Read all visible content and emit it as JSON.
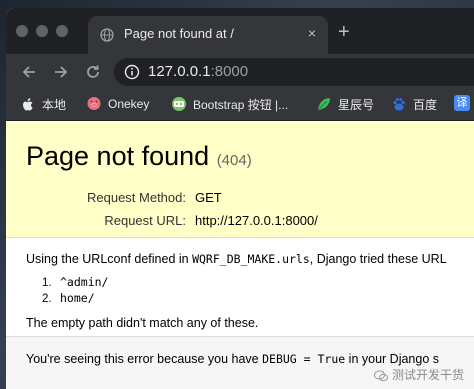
{
  "browser": {
    "tab": {
      "title": "Page not found at /",
      "close_symbol": "×"
    },
    "new_tab_symbol": "+",
    "address": {
      "host": "127.0.0.1",
      "port": ":8000"
    },
    "bookmarks": [
      {
        "label": "本地",
        "icon": "apple-icon",
        "color": "#e8eaed"
      },
      {
        "label": "Onekey",
        "icon": "pig-icon",
        "color": "#e8707e"
      },
      {
        "label": "Bootstrap 按钮 |...",
        "icon": "bootstrap-icon",
        "color": "#7cc46a"
      },
      {
        "label": "星辰号",
        "icon": "leaf-icon",
        "color": "#3cbf5a"
      },
      {
        "label": "百度",
        "icon": "baidu-icon",
        "color": "#2f6de1"
      },
      {
        "label": "译",
        "icon": "translate-icon",
        "color": "#4a8af4"
      }
    ]
  },
  "page": {
    "title": "Page not found",
    "status_code": "(404)",
    "request_method_label": "Request Method:",
    "request_method_value": "GET",
    "request_url_label": "Request URL:",
    "request_url_value": "http://127.0.0.1:8000/",
    "urlconf_prefix": "Using the URLconf defined in ",
    "urlconf_module": "WQRF_DB_MAKE.urls",
    "urlconf_suffix": ", Django tried these URL",
    "patterns": [
      {
        "num": "1.",
        "pattern": "^admin/"
      },
      {
        "num": "2.",
        "pattern": "home/"
      }
    ],
    "empty_path_msg": "The empty path didn't match any of these.",
    "debug_prefix": "You're seeing this error because you have ",
    "debug_code": "DEBUG = True",
    "debug_suffix": " in your Django s"
  },
  "watermark": "测试开发干货"
}
